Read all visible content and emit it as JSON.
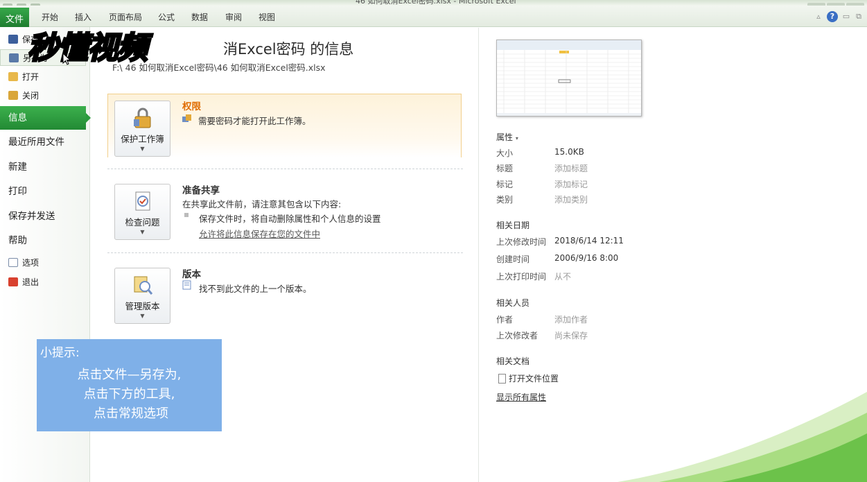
{
  "window": {
    "title": "46 如何取消Excel密码.xlsx - Microsoft Excel"
  },
  "ribbon": {
    "file_tab": "文件",
    "tabs": [
      "开始",
      "插入",
      "页面布局",
      "公式",
      "数据",
      "审阅",
      "视图"
    ]
  },
  "sidebar": {
    "top_items": [
      {
        "label": "保存",
        "icon": "save-icon"
      },
      {
        "label": "另存为",
        "icon": "save-as-icon"
      },
      {
        "label": "打开",
        "icon": "open-folder-icon"
      },
      {
        "label": "关闭",
        "icon": "close-file-icon"
      }
    ],
    "main_items": [
      "信息",
      "最近所用文件",
      "新建",
      "打印",
      "保存并发送",
      "帮助"
    ],
    "bottom_items": [
      {
        "label": "选项",
        "icon": "options-icon"
      },
      {
        "label": "退出",
        "icon": "exit-icon"
      }
    ]
  },
  "info": {
    "title": "关于 46 如何取消Excel密码 的信息",
    "title_visible": "消Excel密码 的信息",
    "path": "F:\\...\\46 如何取消Excel密码\\46 如何取消Excel密码.xlsx",
    "path_visible": "F:\\     46 如何取消Excel密码\\46 如何取消Excel密码.xlsx",
    "permissions": {
      "button": "保护工作簿",
      "heading": "权限",
      "text": "需要密码才能打开此工作簿。"
    },
    "prepare": {
      "button": "检查问题",
      "heading": "准备共享",
      "text": "在共享此文件前，请注意其包含以下内容:",
      "bullet": "保存文件时，将自动删除属性和个人信息的设置",
      "link": "允许将此信息保存在您的文件中"
    },
    "versions": {
      "button": "管理版本",
      "heading": "版本",
      "text": "找不到此文件的上一个版本。"
    }
  },
  "properties": {
    "header": "属性",
    "rows": [
      {
        "key": "大小",
        "value": "15.0KB"
      },
      {
        "key": "标题",
        "value": "添加标题"
      },
      {
        "key": "标记",
        "value": "添加标记"
      },
      {
        "key": "类别",
        "value": "添加类别"
      }
    ],
    "dates_header": "相关日期",
    "dates": [
      {
        "key": "上次修改时间",
        "value": "2018/6/14 12:11"
      },
      {
        "key": "创建时间",
        "value": "2006/9/16 8:00"
      },
      {
        "key": "上次打印时间",
        "value": "从不"
      }
    ],
    "people_header": "相关人员",
    "people": [
      {
        "key": "作者",
        "value": "添加作者"
      },
      {
        "key": "上次修改者",
        "value": "尚未保存"
      }
    ],
    "docs_header": "相关文档",
    "open_location": "打开文件位置",
    "show_all": "显示所有属性"
  },
  "tip": {
    "title": "小提示:",
    "lines": [
      "点击文件—另存为,",
      "点击下方的工具,",
      "点击常规选项"
    ]
  },
  "watermark": {
    "text": "秒懂视频"
  },
  "colors": {
    "accent_green": "#2a9a3c",
    "tip_blue": "#7fb0e8",
    "perm_heading": "#e06c00"
  }
}
